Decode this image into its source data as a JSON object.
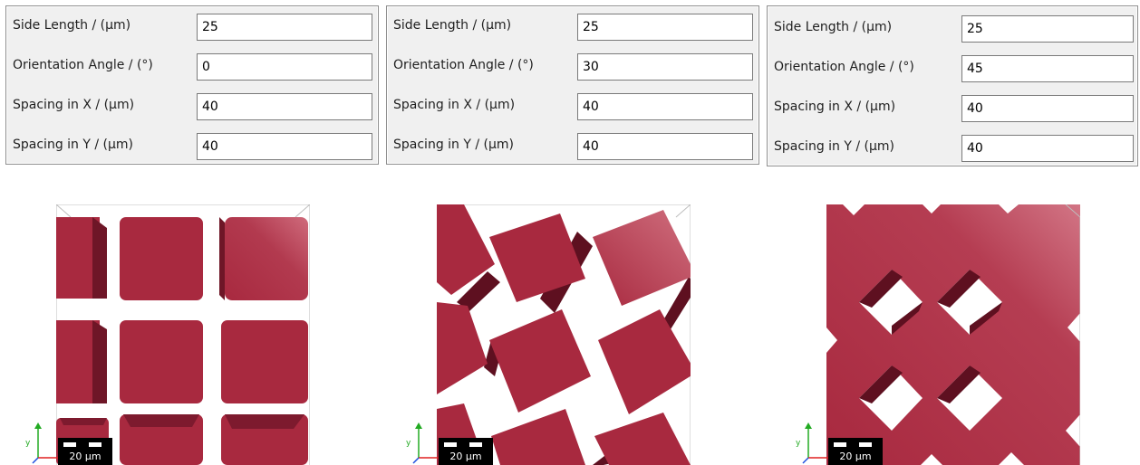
{
  "panels": [
    {
      "rows": [
        {
          "label": "Side Length / (µm)",
          "value": "25"
        },
        {
          "label": "Orientation Angle / (°)",
          "value": "0"
        },
        {
          "label": "Spacing in X / (µm)",
          "value": "40"
        },
        {
          "label": "Spacing in Y / (µm)",
          "value": "40"
        }
      ]
    },
    {
      "rows": [
        {
          "label": "Side Length / (µm)",
          "value": "25"
        },
        {
          "label": "Orientation Angle / (°)",
          "value": "30"
        },
        {
          "label": "Spacing in X / (µm)",
          "value": "40"
        },
        {
          "label": "Spacing in Y / (µm)",
          "value": "40"
        }
      ]
    },
    {
      "rows": [
        {
          "label": "Side Length / (µm)",
          "value": "25"
        },
        {
          "label": "Orientation Angle / (°)",
          "value": "45"
        },
        {
          "label": "Spacing in X / (µm)",
          "value": "40"
        },
        {
          "label": "Spacing in Y / (µm)",
          "value": "40"
        }
      ]
    }
  ],
  "viewports": [
    {
      "scale_label": "20 µm"
    },
    {
      "scale_label": "20 µm"
    },
    {
      "scale_label": "20 µm"
    }
  ],
  "colors": {
    "solid": "#a8293f",
    "solid_highlight": "#c95a6c",
    "solid_shadow": "#5e1020",
    "axis_x": "#e02020",
    "axis_y": "#22aa22",
    "axis_z": "#2050e0"
  }
}
